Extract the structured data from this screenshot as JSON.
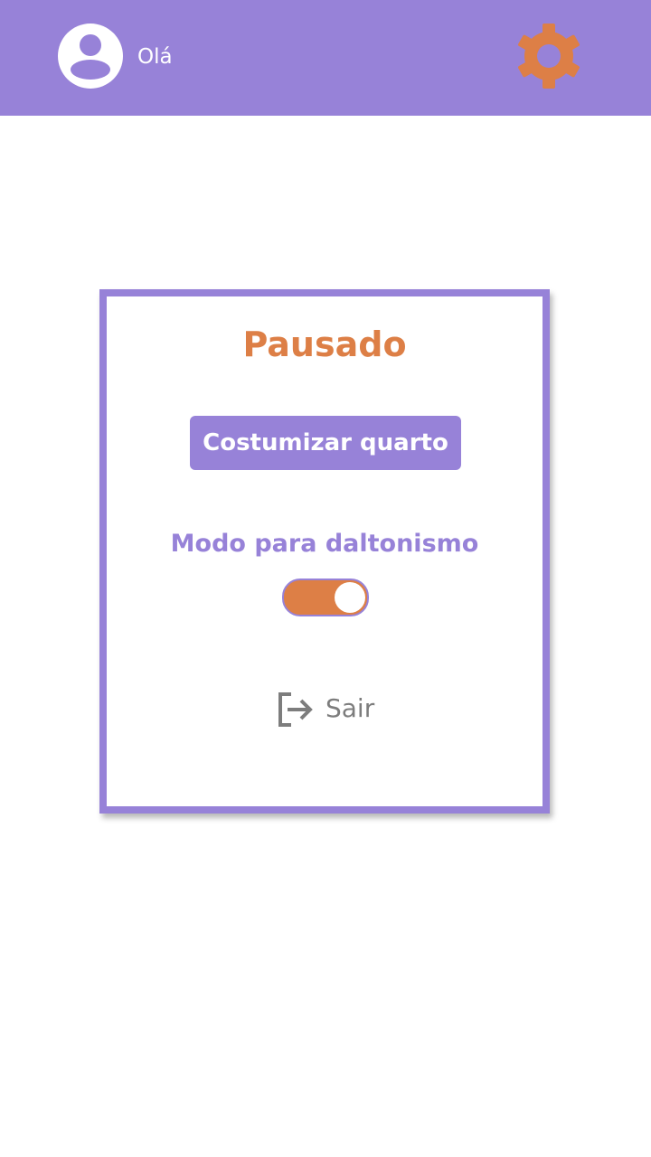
{
  "header": {
    "greeting": "Olá",
    "avatar_icon": "user-avatar-icon",
    "settings_icon": "gear-icon",
    "background_color": "#9782d8"
  },
  "pause_menu": {
    "title": "Pausado",
    "customize_button_label": "Costumizar quarto",
    "colorblind_mode_label": "Modo para daltonismo",
    "colorblind_mode_enabled": true,
    "logout_label": "Sair",
    "logout_icon": "logout-icon"
  },
  "colors": {
    "accent_purple": "#9782d8",
    "accent_orange": "#dd7f46",
    "muted_gray": "#7d7d7d"
  }
}
